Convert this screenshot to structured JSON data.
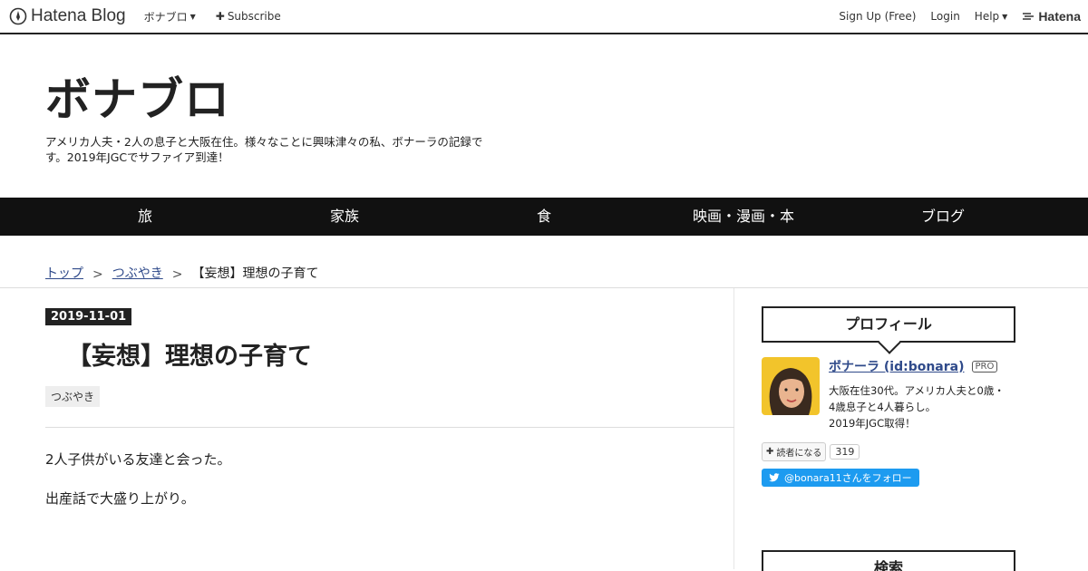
{
  "global_header": {
    "logo_text": "Hatena Blog",
    "blog_menu": "ボナブロ",
    "subscribe": "Subscribe",
    "signup": "Sign Up (Free)",
    "login": "Login",
    "help": "Help",
    "hatena": "Hatena"
  },
  "blog": {
    "title": "ボナブロ",
    "description": "アメリカ人夫・2人の息子と大阪在住。様々なことに興味津々の私、ボナーラの記録です。2019年JGCでサファイア到達！"
  },
  "nav": [
    "旅",
    "家族",
    "食",
    "映画・漫画・本",
    "ブログ"
  ],
  "breadcrumb": {
    "top": "トップ",
    "sep": ">",
    "category": "つぶやき",
    "current": "【妄想】理想の子育て"
  },
  "entry": {
    "date": "2019-11-01",
    "title": "【妄想】理想の子育て",
    "category": "つぶやき",
    "paragraphs": [
      "2人子供がいる友達と会った。",
      "出産話で大盛り上がり。"
    ]
  },
  "sidebar": {
    "profile_heading": "プロフィール",
    "name": "ボナーラ (id:bonara)",
    "badge": "PRO",
    "desc": [
      "大阪在住30代。アメリカ人夫と0歳・",
      "4歳息子と4人暮らし。",
      "2019年JGC取得！"
    ],
    "reader_label": "読者になる",
    "reader_count": "319",
    "twitter_label": "@bonara11さんをフォロー",
    "search_heading": "検索"
  }
}
